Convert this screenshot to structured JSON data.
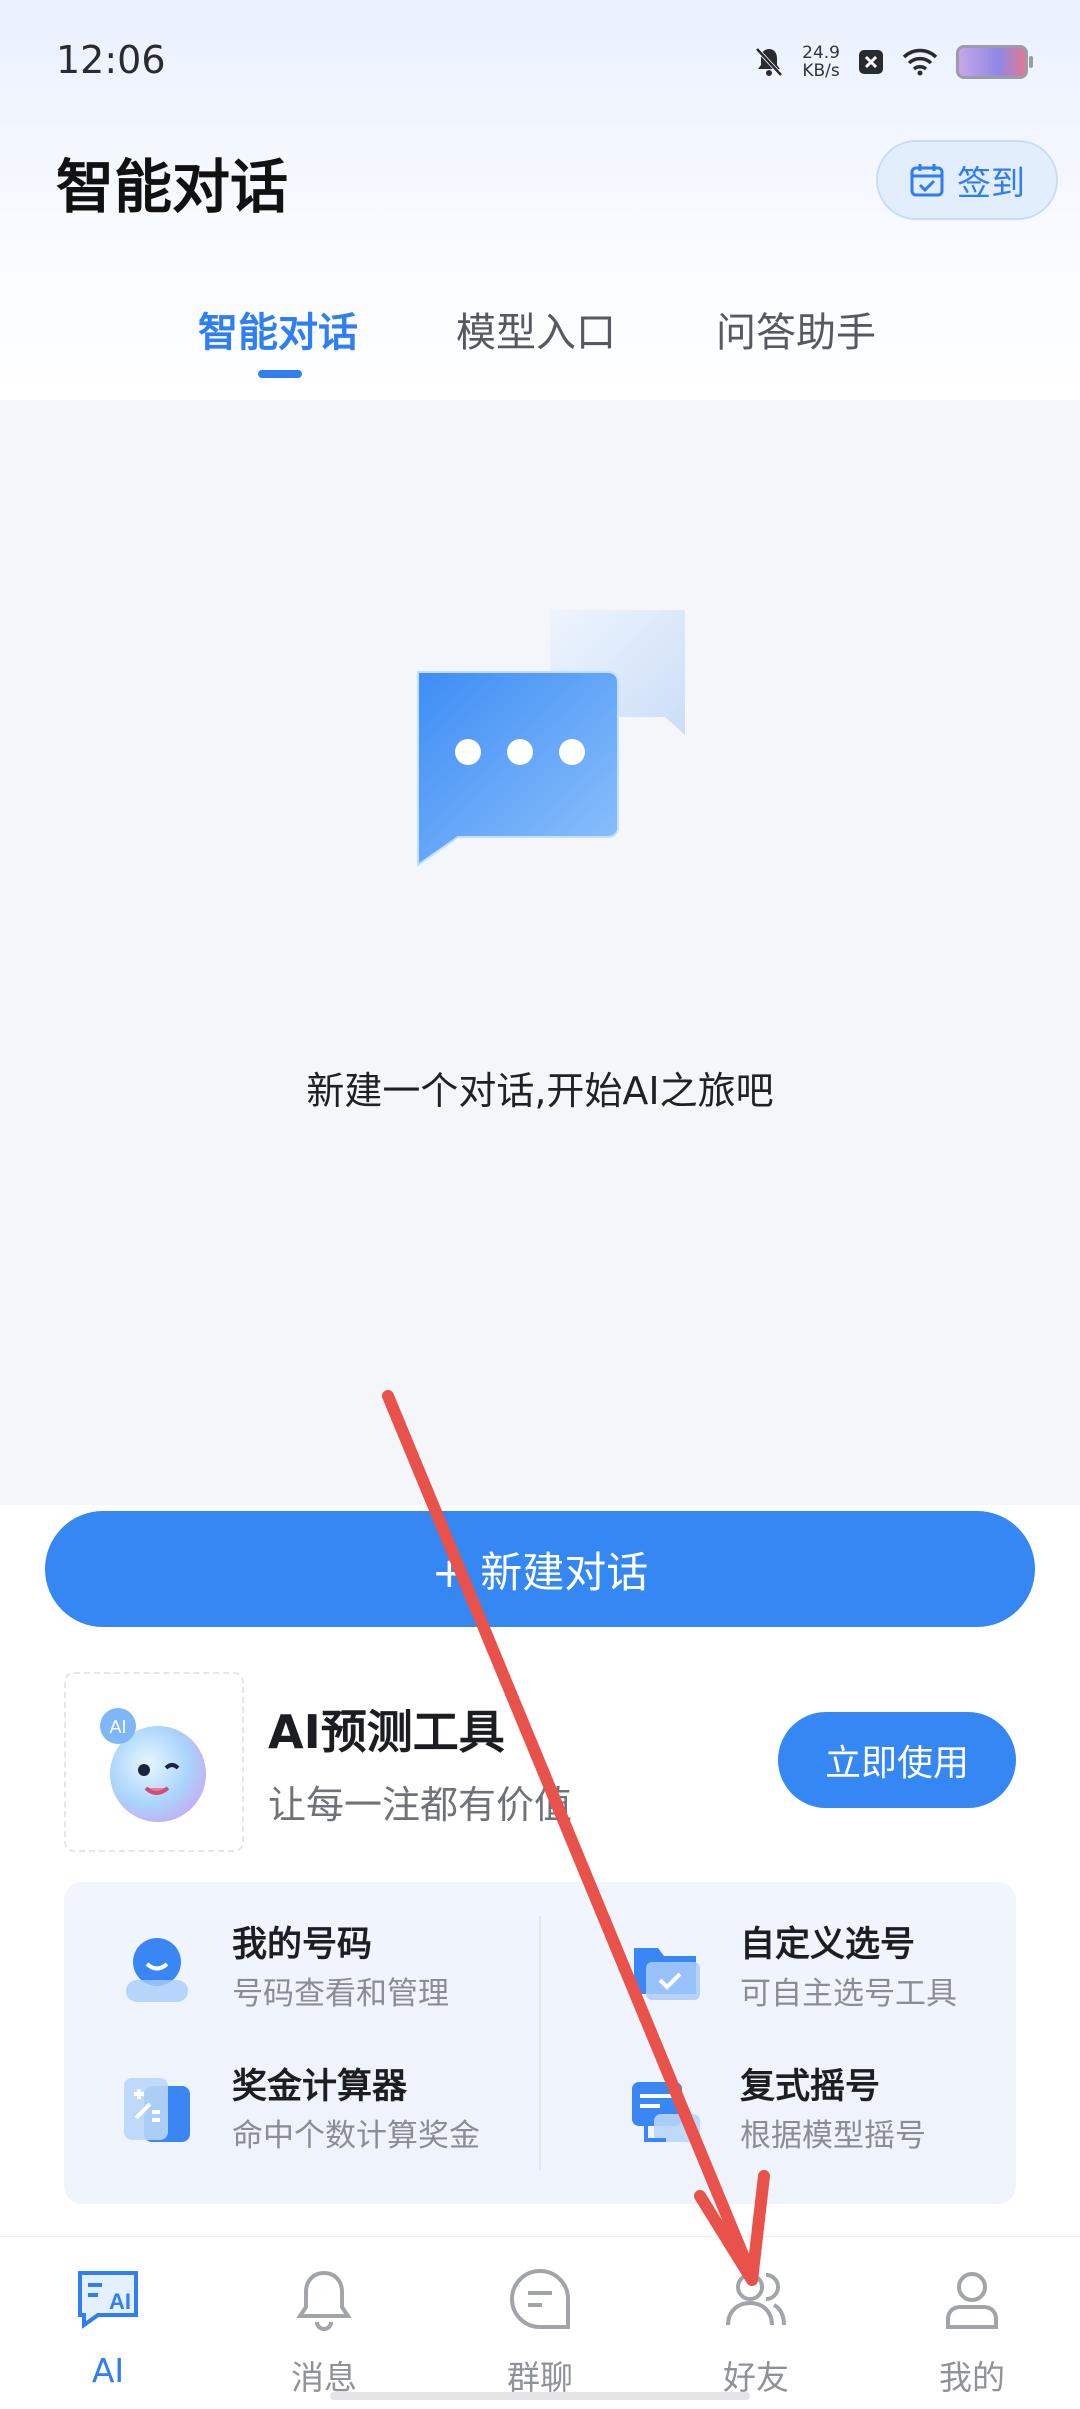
{
  "status_bar": {
    "time": "12:06",
    "net_speed_value": "24.9",
    "net_speed_unit": "KB/s",
    "icons": [
      "bell-muted-icon",
      "x-box-icon",
      "wifi-icon",
      "battery-icon"
    ]
  },
  "header": {
    "title": "智能对话",
    "checkin_label": "签到"
  },
  "tabs": [
    {
      "label": "智能对话",
      "active": true
    },
    {
      "label": "模型入口",
      "active": false
    },
    {
      "label": "问答助手",
      "active": false
    }
  ],
  "empty_state": {
    "message": "新建一个对话,开始AI之旅吧"
  },
  "new_chat_button": "+ 新建对话",
  "promo": {
    "title": "AI预测工具",
    "subtitle": "让每一注都有价值",
    "button": "立即使用"
  },
  "tools": [
    {
      "title": "我的号码",
      "subtitle": "号码查看和管理"
    },
    {
      "title": "自定义选号",
      "subtitle": "可自主选号工具"
    },
    {
      "title": "奖金计算器",
      "subtitle": "命中个数计算奖金"
    },
    {
      "title": "复式摇号",
      "subtitle": "根据模型摇号"
    }
  ],
  "bottom_nav": [
    {
      "label": "AI",
      "icon": "ai-chat-icon",
      "active": true
    },
    {
      "label": "消息",
      "icon": "bell-icon",
      "active": false
    },
    {
      "label": "群聊",
      "icon": "chat-bubble-icon",
      "active": false
    },
    {
      "label": "好友",
      "icon": "friends-icon",
      "active": false
    },
    {
      "label": "我的",
      "icon": "person-icon",
      "active": false
    }
  ],
  "colors": {
    "accent": "#2f7ef2",
    "button": "#3588f3",
    "annotation_arrow": "#e8524a"
  }
}
